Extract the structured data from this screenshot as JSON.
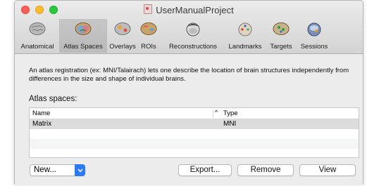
{
  "window": {
    "title": "UserManualProject"
  },
  "toolbar": {
    "tabs": [
      {
        "label": "Anatomical",
        "icon": "brain-gray-icon",
        "selected": false
      },
      {
        "label": "Atlas Spaces",
        "icon": "brain-colored-icon",
        "selected": true
      },
      {
        "label": "Overlays",
        "icon": "brain-overlay-icon",
        "selected": false
      },
      {
        "label": "ROIs",
        "icon": "brain-roi-icon",
        "selected": false
      },
      {
        "label": "Reconstructions",
        "icon": "head-surface-icon",
        "selected": false
      },
      {
        "label": "Landmarks",
        "icon": "head-landmarks-icon",
        "selected": false
      },
      {
        "label": "Targets",
        "icon": "brain-targets-icon",
        "selected": false
      },
      {
        "label": "Sessions",
        "icon": "head-sessions-icon",
        "selected": false
      }
    ]
  },
  "content": {
    "description": "An atlas registration (ex: MNI/Talairach) lets one describe the location of brain structures independently from differences in the size and shape of individual brains.",
    "section_label": "Atlas spaces:",
    "table": {
      "columns": {
        "name": "Name",
        "sort_indicator": "^",
        "type": "Type"
      },
      "rows": [
        {
          "name": "Matrix",
          "type": "MNI"
        }
      ]
    },
    "buttons": {
      "new_label": "New...",
      "export_label": "Export...",
      "remove_label": "Remove",
      "view_label": "View"
    }
  }
}
